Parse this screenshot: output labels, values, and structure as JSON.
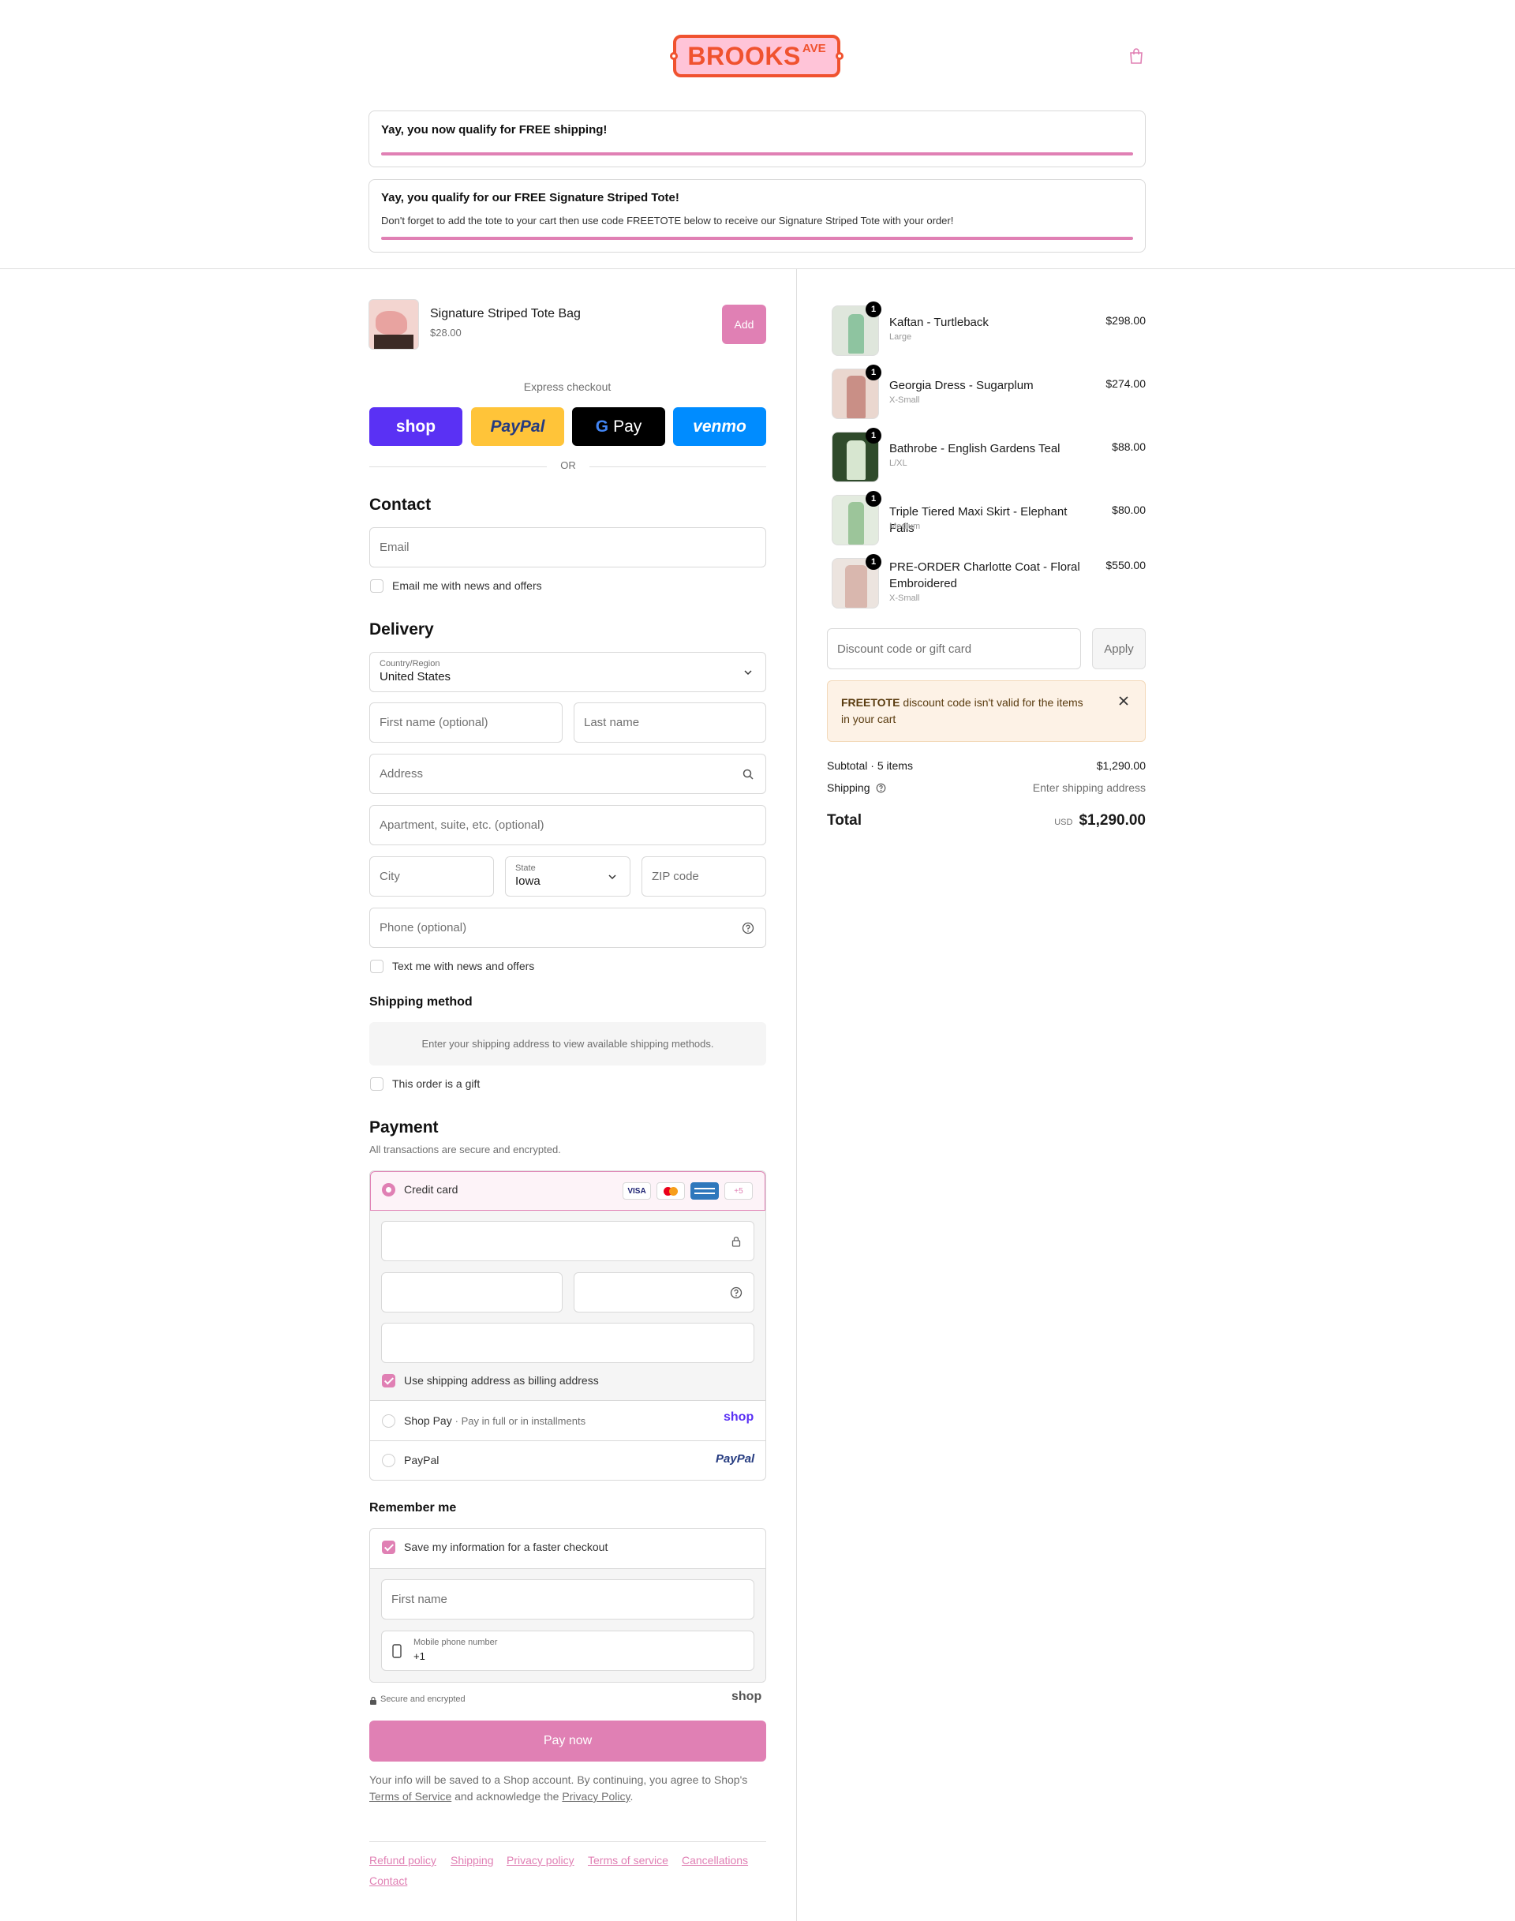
{
  "header": {
    "logo_main": "BROOKS",
    "logo_sup": "AVE"
  },
  "banners": {
    "shipping_title": "Yay, you now qualify for FREE shipping!",
    "tote_title": "Yay, you qualify for our FREE Signature Striped Tote!",
    "tote_desc": "Don't forget to add the tote to your cart then use code FREETOTE below to receive our Signature Striped Tote with your order!",
    "accent_color": "#e080b4"
  },
  "upsell": {
    "name": "Signature Striped Tote Bag",
    "price": "$28.00",
    "add_label": "Add"
  },
  "express": {
    "title": "Express checkout",
    "shop": "shop",
    "paypal": "PayPal",
    "gpay": "Pay",
    "venmo": "venmo",
    "or": "OR"
  },
  "contact": {
    "title": "Contact",
    "email_placeholder": "Email",
    "news_label": "Email me with news and offers"
  },
  "delivery": {
    "title": "Delivery",
    "country_label": "Country/Region",
    "country_value": "United States",
    "first_name": "First name (optional)",
    "last_name": "Last name",
    "address": "Address",
    "apartment": "Apartment, suite, etc. (optional)",
    "city": "City",
    "state_label": "State",
    "state_value": "Iowa",
    "zip": "ZIP code",
    "phone": "Phone (optional)",
    "text_label": "Text me with news and offers"
  },
  "shipping_method": {
    "title": "Shipping method",
    "message": "Enter your shipping address to view available shipping methods.",
    "gift_label": "This order is a gift"
  },
  "payment": {
    "title": "Payment",
    "subtitle": "All transactions are secure and encrypted.",
    "credit_card": "Credit card",
    "visa": "VISA",
    "more_cards": "+5",
    "billing_label": "Use shipping address as billing address",
    "shop_pay": "Shop Pay",
    "shop_pay_sub": "Pay in full or in installments",
    "shop_logo": "shop",
    "paypal": "PayPal",
    "paypal_logo": "PayPal"
  },
  "remember": {
    "title": "Remember me",
    "save_label": "Save my information for a faster checkout",
    "first_name": "First name",
    "phone_label": "Mobile phone number",
    "phone_value": "+1",
    "secure": "Secure and encrypted",
    "shop_logo": "shop"
  },
  "pay_now": "Pay now",
  "legal": {
    "line1": "Your info will be saved to a Shop account. By continuing, you agree to Shop's",
    "terms": "Terms of Service",
    "mid": "and acknowledge the",
    "privacy": "Privacy Policy",
    "end": "."
  },
  "footer_links": [
    "Refund policy",
    "Shipping",
    "Privacy policy",
    "Terms of service",
    "Cancellations",
    "Contact"
  ],
  "order": {
    "items": [
      {
        "name": "Kaftan - Turtleback",
        "variant": "Large",
        "price": "$298.00",
        "qty": "1"
      },
      {
        "name": "Georgia Dress - Sugarplum",
        "variant": "X-Small",
        "price": "$274.00",
        "qty": "1"
      },
      {
        "name": "Bathrobe - English Gardens Teal",
        "variant": "L/XL",
        "price": "$88.00",
        "qty": "1"
      },
      {
        "name": "Triple Tiered Maxi Skirt - Elephant Falls",
        "variant": "Medium",
        "price": "$80.00",
        "qty": "1"
      },
      {
        "name": "PRE-ORDER Charlotte Coat - Floral Embroidered",
        "variant": "X-Small",
        "price": "$550.00",
        "qty": "1"
      }
    ],
    "discount_placeholder": "Discount code or gift card",
    "apply": "Apply",
    "error_code": "FREETOTE",
    "error_msg": "discount code isn't valid for the items in your cart",
    "subtotal_label": "Subtotal · 5 items",
    "subtotal_value": "$1,290.00",
    "shipping_label": "Shipping",
    "shipping_value": "Enter shipping address",
    "total_label": "Total",
    "currency": "USD",
    "total_value": "$1,290.00"
  }
}
